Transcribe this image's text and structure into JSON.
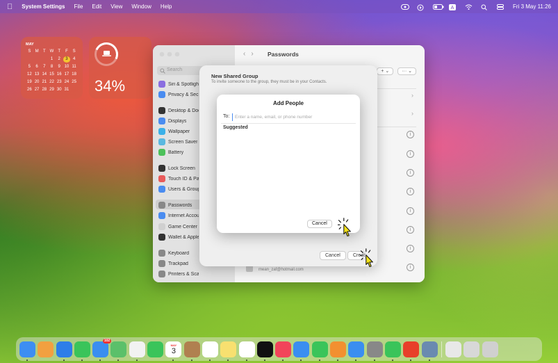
{
  "menubar": {
    "app_name": "System Settings",
    "items": [
      "File",
      "Edit",
      "View",
      "Window",
      "Help"
    ],
    "clock": "Fri 3 May  11:26"
  },
  "calendar_widget": {
    "month": "MAY",
    "weekdays": [
      "S",
      "M",
      "T",
      "W",
      "T",
      "F",
      "S"
    ],
    "days": [
      "",
      "",
      "",
      "1",
      "2",
      "3",
      "4",
      "5",
      "6",
      "7",
      "8",
      "9",
      "10",
      "11",
      "12",
      "13",
      "14",
      "15",
      "16",
      "17",
      "18",
      "19",
      "20",
      "21",
      "22",
      "23",
      "24",
      "25",
      "26",
      "27",
      "28",
      "29",
      "30",
      "31",
      ""
    ],
    "today": "3"
  },
  "battery_widget": {
    "percent": "34%"
  },
  "settings_window": {
    "title": "Passwords",
    "search_placeholder": "Search",
    "sidebar": [
      {
        "label": "Siri & Spotlight",
        "color": "#8a6ee0"
      },
      {
        "label": "Privacy & Security",
        "color": "#4a8cf0"
      },
      {
        "label": "Desktop & Dock",
        "color": "#333333"
      },
      {
        "label": "Displays",
        "color": "#4a8cf0"
      },
      {
        "label": "Wallpaper",
        "color": "#3bb0e8"
      },
      {
        "label": "Screen Saver",
        "color": "#5ab8e0"
      },
      {
        "label": "Battery",
        "color": "#4cc15a"
      },
      {
        "label": "Lock Screen",
        "color": "#333333"
      },
      {
        "label": "Touch ID & Password",
        "color": "#e85a5a"
      },
      {
        "label": "Users & Groups",
        "color": "#4a8cf0"
      },
      {
        "label": "Passwords",
        "color": "#888888"
      },
      {
        "label": "Internet Accounts",
        "color": "#4a8cf0"
      },
      {
        "label": "Game Center",
        "color": "#d0d0d0"
      },
      {
        "label": "Wallet & Apple Pay",
        "color": "#333333"
      },
      {
        "label": "Keyboard",
        "color": "#888888"
      },
      {
        "label": "Trackpad",
        "color": "#888888"
      },
      {
        "label": "Printers & Scanners",
        "color": "#888888"
      }
    ],
    "toolbar": {
      "add": "+",
      "more": "···"
    },
    "bottom_email": "mean_zaf@hotmail.com"
  },
  "new_group_sheet": {
    "title": "New Shared Group",
    "subtitle": "To invite someone to the group, they must be in your Contacts.",
    "cancel_label": "Cancel",
    "create_label": "Create"
  },
  "add_people_dialog": {
    "title": "Add People",
    "to_label": "To:",
    "field_placeholder": "Enter a name, email, or phone number",
    "suggested_label": "Suggested",
    "cancel_label": "Cancel"
  },
  "dock": {
    "mail_badge": "102",
    "calendar_month": "MAY",
    "calendar_day": "3",
    "apps": [
      {
        "name": "finder",
        "color": "#3d8ef2"
      },
      {
        "name": "launchpad",
        "color": "#f2a040"
      },
      {
        "name": "safari",
        "color": "#2d7ee8"
      },
      {
        "name": "messages",
        "color": "#3ac45a"
      },
      {
        "name": "mail",
        "color": "#3a8ef0"
      },
      {
        "name": "maps",
        "color": "#5bc06a"
      },
      {
        "name": "photos",
        "color": "#f2f2f2"
      },
      {
        "name": "facetime",
        "color": "#3ac45a"
      },
      {
        "name": "calendar",
        "color": "#ffffff"
      },
      {
        "name": "contacts",
        "color": "#b08050"
      },
      {
        "name": "reminders",
        "color": "#ffffff"
      },
      {
        "name": "notes",
        "color": "#f8e070"
      },
      {
        "name": "freeform",
        "color": "#ffffff"
      },
      {
        "name": "tv",
        "color": "#111111"
      },
      {
        "name": "music",
        "color": "#f2445a"
      },
      {
        "name": "keynote",
        "color": "#3a8ef0"
      },
      {
        "name": "numbers",
        "color": "#3ac45a"
      },
      {
        "name": "pages",
        "color": "#f29030"
      },
      {
        "name": "app-store",
        "color": "#3a8ef0"
      },
      {
        "name": "system-settings",
        "color": "#888888"
      },
      {
        "name": "line",
        "color": "#3ac45a"
      },
      {
        "name": "ea",
        "color": "#e8402a"
      },
      {
        "name": "preview",
        "color": "#6a8ab0"
      },
      {
        "name": "music-doc",
        "color": "#e8e8e8"
      },
      {
        "name": "downloads",
        "color": "#d8d8d8"
      },
      {
        "name": "trash",
        "color": "#d0d0d0"
      }
    ]
  }
}
